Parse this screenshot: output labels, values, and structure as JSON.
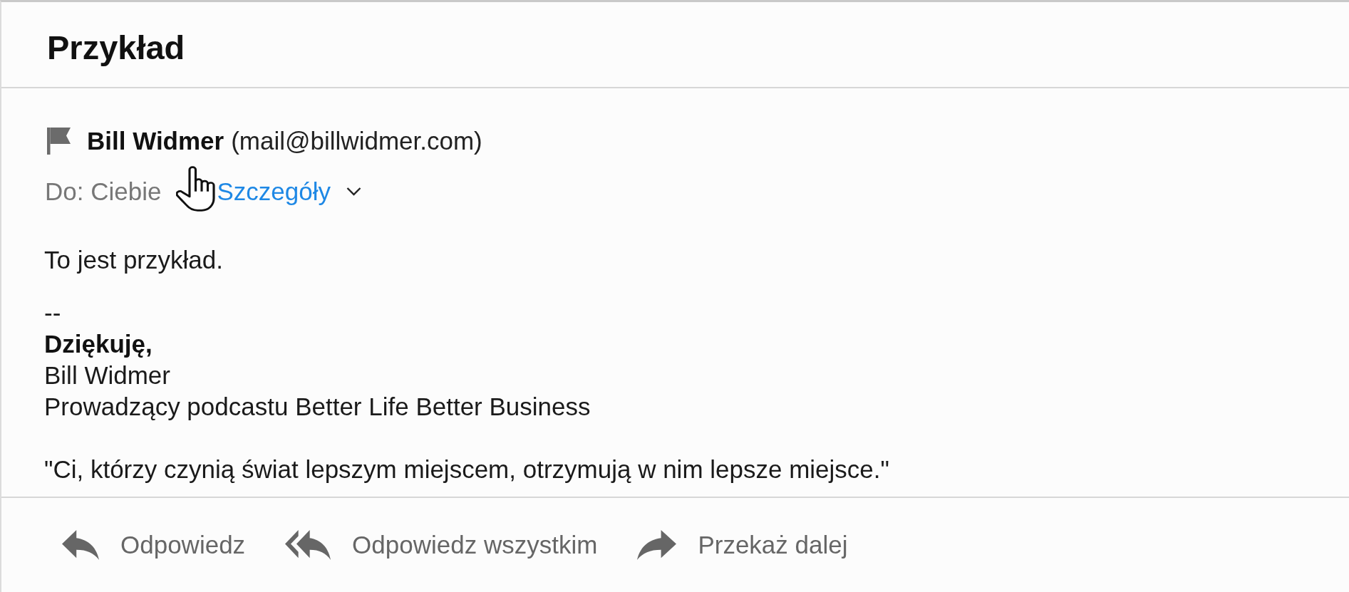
{
  "message": {
    "subject": "Przykład",
    "sender": {
      "name": "Bill Widmer",
      "email": "(mail@billwidmer.com)"
    },
    "recipient": {
      "text": "Do: Ciebie",
      "details_link": "Szczegóły",
      "details_expanded": false
    },
    "body": "To jest przykład.",
    "signature": {
      "separator": "--",
      "closing": "Dziękuję,",
      "name": "Bill Widmer",
      "role": "Prowadzący podcastu Better Life Better Business"
    },
    "quote": "\"Ci, którzy czynią świat lepszym miejscem, otrzymują w nim lepsze miejsce.\""
  },
  "actions": [
    {
      "kind": "reply",
      "label": "Odpowiedz"
    },
    {
      "kind": "reply_all",
      "label": "Odpowiedz wszystkim"
    },
    {
      "kind": "forward",
      "label": "Przekaż dalej"
    }
  ]
}
